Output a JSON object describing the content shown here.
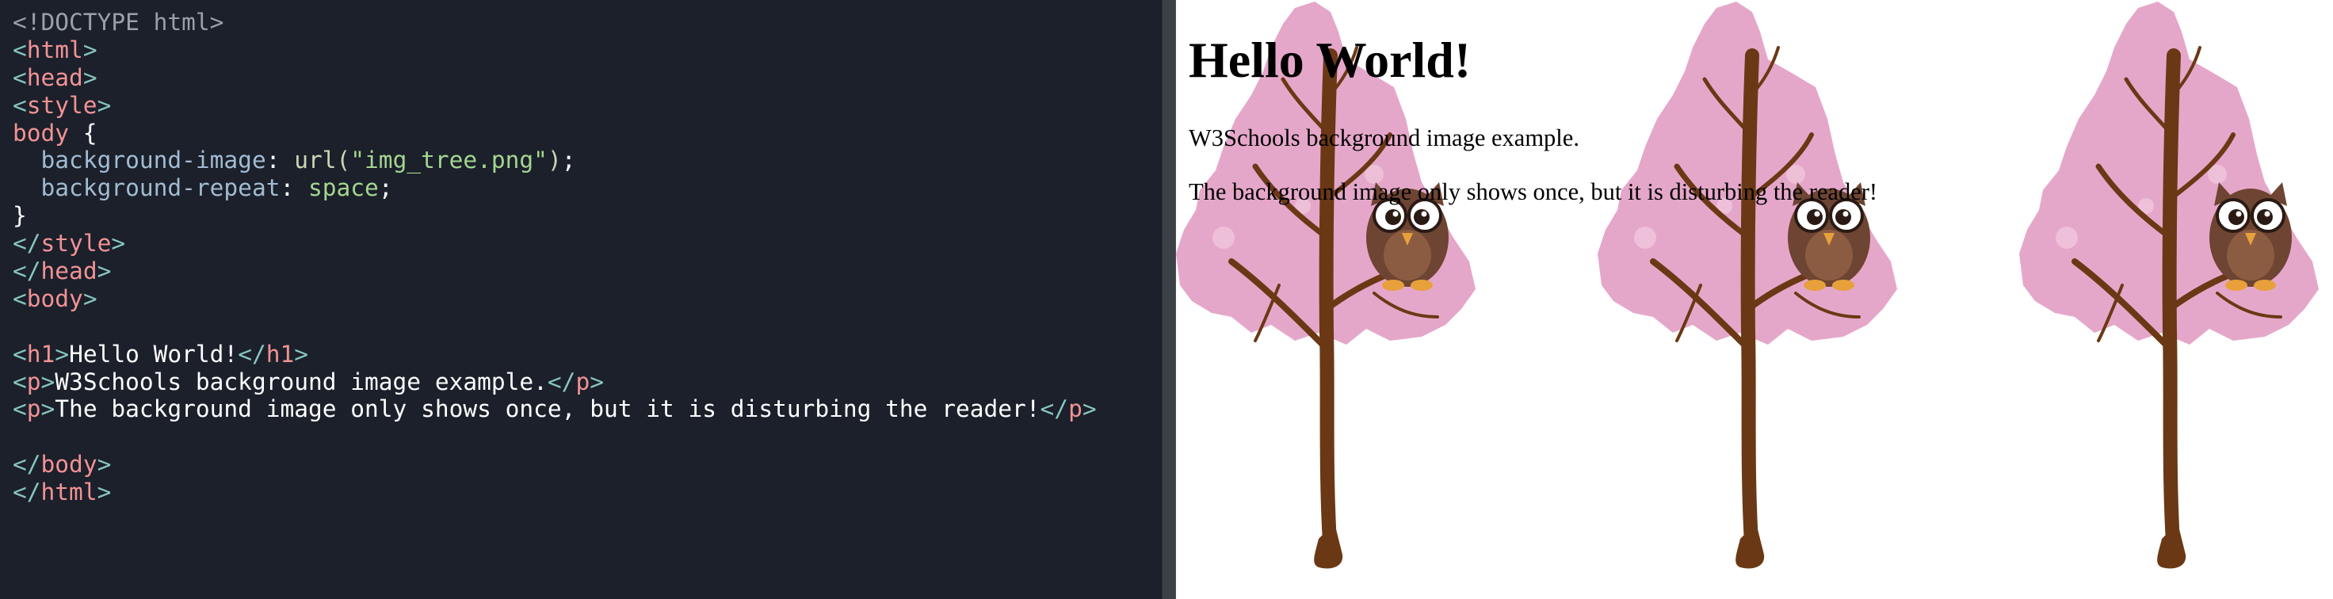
{
  "editor": {
    "code_lines": [
      [
        {
          "k": "doctype",
          "t": "<!DOCTYPE html>"
        }
      ],
      [
        {
          "k": "bracket",
          "t": "<"
        },
        {
          "k": "tag",
          "t": "html"
        },
        {
          "k": "bracket",
          "t": ">"
        }
      ],
      [
        {
          "k": "bracket",
          "t": "<"
        },
        {
          "k": "tag",
          "t": "head"
        },
        {
          "k": "bracket",
          "t": ">"
        }
      ],
      [
        {
          "k": "bracket",
          "t": "<"
        },
        {
          "k": "tag",
          "t": "style"
        },
        {
          "k": "bracket",
          "t": ">"
        }
      ],
      [
        {
          "k": "sel",
          "t": "body"
        },
        {
          "k": "text",
          "t": " {"
        }
      ],
      [
        {
          "k": "text",
          "t": "  "
        },
        {
          "k": "prop",
          "t": "background-image"
        },
        {
          "k": "text",
          "t": ": "
        },
        {
          "k": "func",
          "t": "url("
        },
        {
          "k": "str",
          "t": "\"img_tree.png\""
        },
        {
          "k": "func",
          "t": ")"
        },
        {
          "k": "text",
          "t": ";"
        }
      ],
      [
        {
          "k": "text",
          "t": "  "
        },
        {
          "k": "prop",
          "t": "background-repeat"
        },
        {
          "k": "text",
          "t": ": "
        },
        {
          "k": "val",
          "t": "space"
        },
        {
          "k": "text",
          "t": ";"
        }
      ],
      [
        {
          "k": "text",
          "t": "}"
        }
      ],
      [
        {
          "k": "bracket",
          "t": "</"
        },
        {
          "k": "tag",
          "t": "style"
        },
        {
          "k": "bracket",
          "t": ">"
        }
      ],
      [
        {
          "k": "bracket",
          "t": "</"
        },
        {
          "k": "tag",
          "t": "head"
        },
        {
          "k": "bracket",
          "t": ">"
        }
      ],
      [
        {
          "k": "bracket",
          "t": "<"
        },
        {
          "k": "tag",
          "t": "body"
        },
        {
          "k": "bracket",
          "t": ">"
        }
      ],
      [],
      [
        {
          "k": "bracket",
          "t": "<"
        },
        {
          "k": "tag",
          "t": "h1"
        },
        {
          "k": "bracket",
          "t": ">"
        },
        {
          "k": "text",
          "t": "Hello World!"
        },
        {
          "k": "bracket",
          "t": "</"
        },
        {
          "k": "tag",
          "t": "h1"
        },
        {
          "k": "bracket",
          "t": ">"
        }
      ],
      [
        {
          "k": "bracket",
          "t": "<"
        },
        {
          "k": "tag",
          "t": "p"
        },
        {
          "k": "bracket",
          "t": ">"
        },
        {
          "k": "text",
          "t": "W3Schools background image example."
        },
        {
          "k": "bracket",
          "t": "</"
        },
        {
          "k": "tag",
          "t": "p"
        },
        {
          "k": "bracket",
          "t": ">"
        }
      ],
      [
        {
          "k": "bracket",
          "t": "<"
        },
        {
          "k": "tag",
          "t": "p"
        },
        {
          "k": "bracket",
          "t": ">"
        },
        {
          "k": "text",
          "t": "The background image only shows once, but it is disturbing the reader!"
        },
        {
          "k": "bracket",
          "t": "</"
        },
        {
          "k": "tag",
          "t": "p"
        },
        {
          "k": "bracket",
          "t": ">"
        }
      ],
      [],
      [
        {
          "k": "bracket",
          "t": "</"
        },
        {
          "k": "tag",
          "t": "body"
        },
        {
          "k": "bracket",
          "t": ">"
        }
      ],
      [
        {
          "k": "bracket",
          "t": "</"
        },
        {
          "k": "tag",
          "t": "html"
        },
        {
          "k": "bracket",
          "t": ">"
        }
      ]
    ]
  },
  "preview": {
    "heading": "Hello World!",
    "paragraph_1": "W3Schools background image example.",
    "paragraph_2": "The background image only shows once, but it is disturbing the reader!"
  },
  "colors": {
    "editor_bg": "#1b202b",
    "tag": "#f39294",
    "bracket": "#88c6be",
    "property": "#a2bbd1",
    "string": "#a5d68f",
    "blossom": "#e5a7c9",
    "trunk": "#6b3815",
    "owl": "#6e4432"
  }
}
